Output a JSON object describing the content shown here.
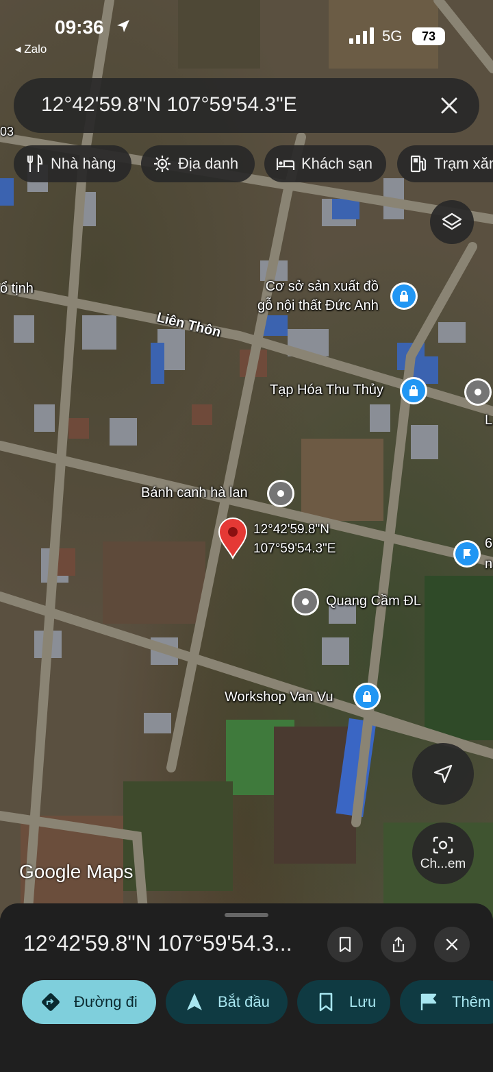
{
  "status_bar": {
    "time": "09:36",
    "back_app": "◂ Zalo",
    "network": "5G",
    "battery": "73"
  },
  "search": {
    "query": "12°42'59.8\"N 107°59'54.3\"E"
  },
  "chips": [
    {
      "label": "Nhà hàng",
      "icon": "fork-knife-icon"
    },
    {
      "label": "Địa danh",
      "icon": "landmark-icon"
    },
    {
      "label": "Khách sạn",
      "icon": "bed-icon"
    },
    {
      "label": "Trạm xăng",
      "icon": "gas-station-icon"
    }
  ],
  "map": {
    "road_labels": {
      "lien_thon": "Liên Thôn",
      "tinh": "ổ tịnh",
      "edge_03": "03",
      "edge_L": "L",
      "edge_6": "6",
      "edge_n": "n"
    },
    "places": {
      "co_so": "Cơ sở sản xuất đồ\ngỗ nội thất Đức Anh",
      "tap_hoa": "Tạp Hóa Thu Thủy",
      "banh_canh": "Bánh canh hà lan",
      "quang_cam": "Quang Cầm ĐL",
      "workshop": "Workshop Van Vu"
    },
    "pin_label_line1": "12°42'59.8\"N",
    "pin_label_line2": "107°59'54.3\"E",
    "camera_button_label": "Ch...em",
    "attribution": "Google Maps"
  },
  "sheet": {
    "title": "12°42'59.8\"N 107°59'54.3...",
    "actions": [
      {
        "label": "Đường đi",
        "icon": "directions-icon",
        "accent": "#7fcfdc"
      },
      {
        "label": "Bắt đầu",
        "icon": "navigation-arrow-icon"
      },
      {
        "label": "Lưu",
        "icon": "bookmark-icon"
      },
      {
        "label": "Thêm",
        "icon": "flag-icon"
      }
    ]
  },
  "colors": {
    "pin_red": "#e53935",
    "poi_blue": "#2196f3",
    "poi_gray": "#757575",
    "primary_pill": "#7fcfdc",
    "secondary_pill": "#0f3a42",
    "secondary_text": "#a8e6f0"
  }
}
